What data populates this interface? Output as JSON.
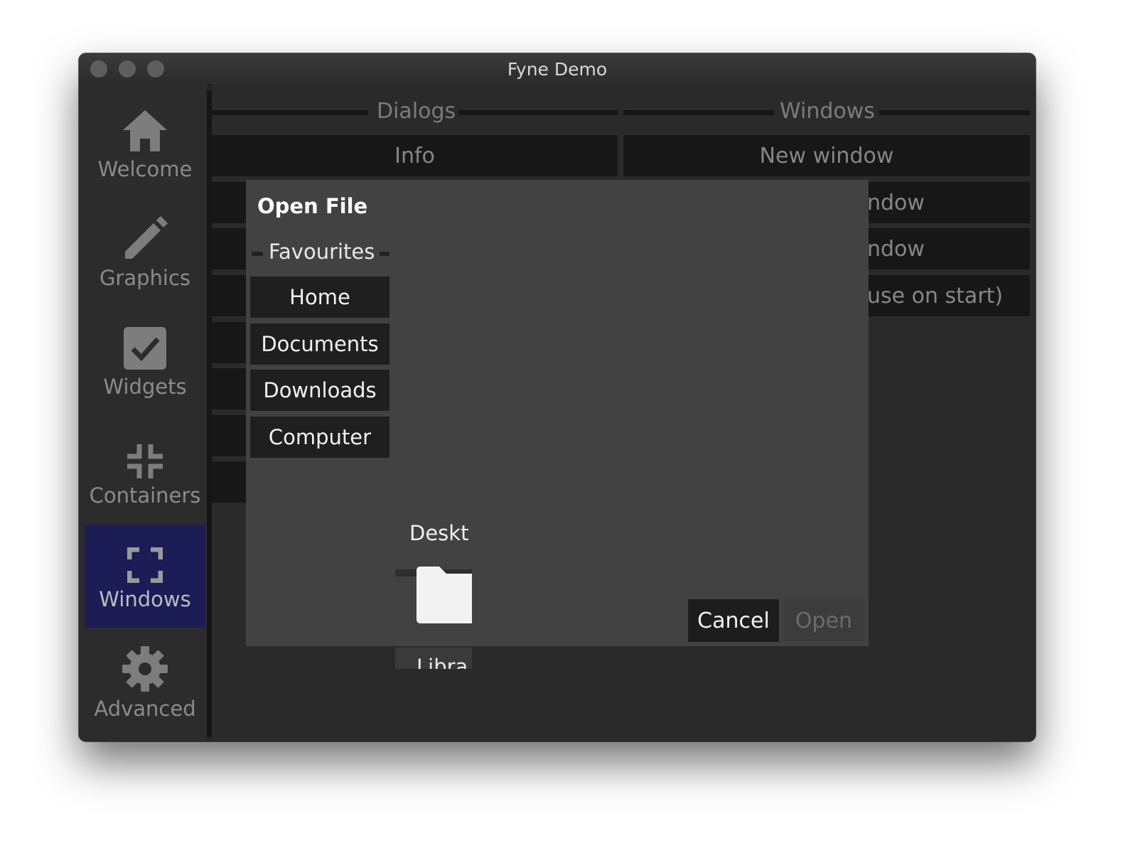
{
  "window": {
    "title": "Fyne Demo"
  },
  "sidebar": {
    "items": [
      {
        "label": "Welcome",
        "icon": "home-icon"
      },
      {
        "label": "Graphics",
        "icon": "pencil-icon"
      },
      {
        "label": "Widgets",
        "icon": "checkbox-icon"
      },
      {
        "label": "Containers",
        "icon": "collapse-icon"
      },
      {
        "label": "Windows",
        "icon": "fullscreen-icon",
        "selected": true
      },
      {
        "label": "Advanced",
        "icon": "gear-icon"
      }
    ]
  },
  "main": {
    "dialogs_header": "Dialogs",
    "windows_header": "Windows",
    "info_button": "Info",
    "new_window_button": "New window",
    "partial_button_1": "ndow",
    "partial_button_2": "ndow",
    "partial_button_3": "use on start)"
  },
  "dialog": {
    "title": "Open File",
    "favourites_header": "Favourites",
    "favourites": [
      "Home",
      "Documents",
      "Downloads",
      "Computer"
    ],
    "files": [
      {
        "name": "Deskt",
        "icon": "folder-icon"
      },
      {
        "name": "Libra",
        "icon": "folder-icon"
      }
    ],
    "cancel_label": "Cancel",
    "open_label": "Open"
  },
  "colors": {
    "selected_nav": "#1c1c57",
    "dialog_bg": "#424242",
    "button_bg": "#1f1f1f"
  }
}
